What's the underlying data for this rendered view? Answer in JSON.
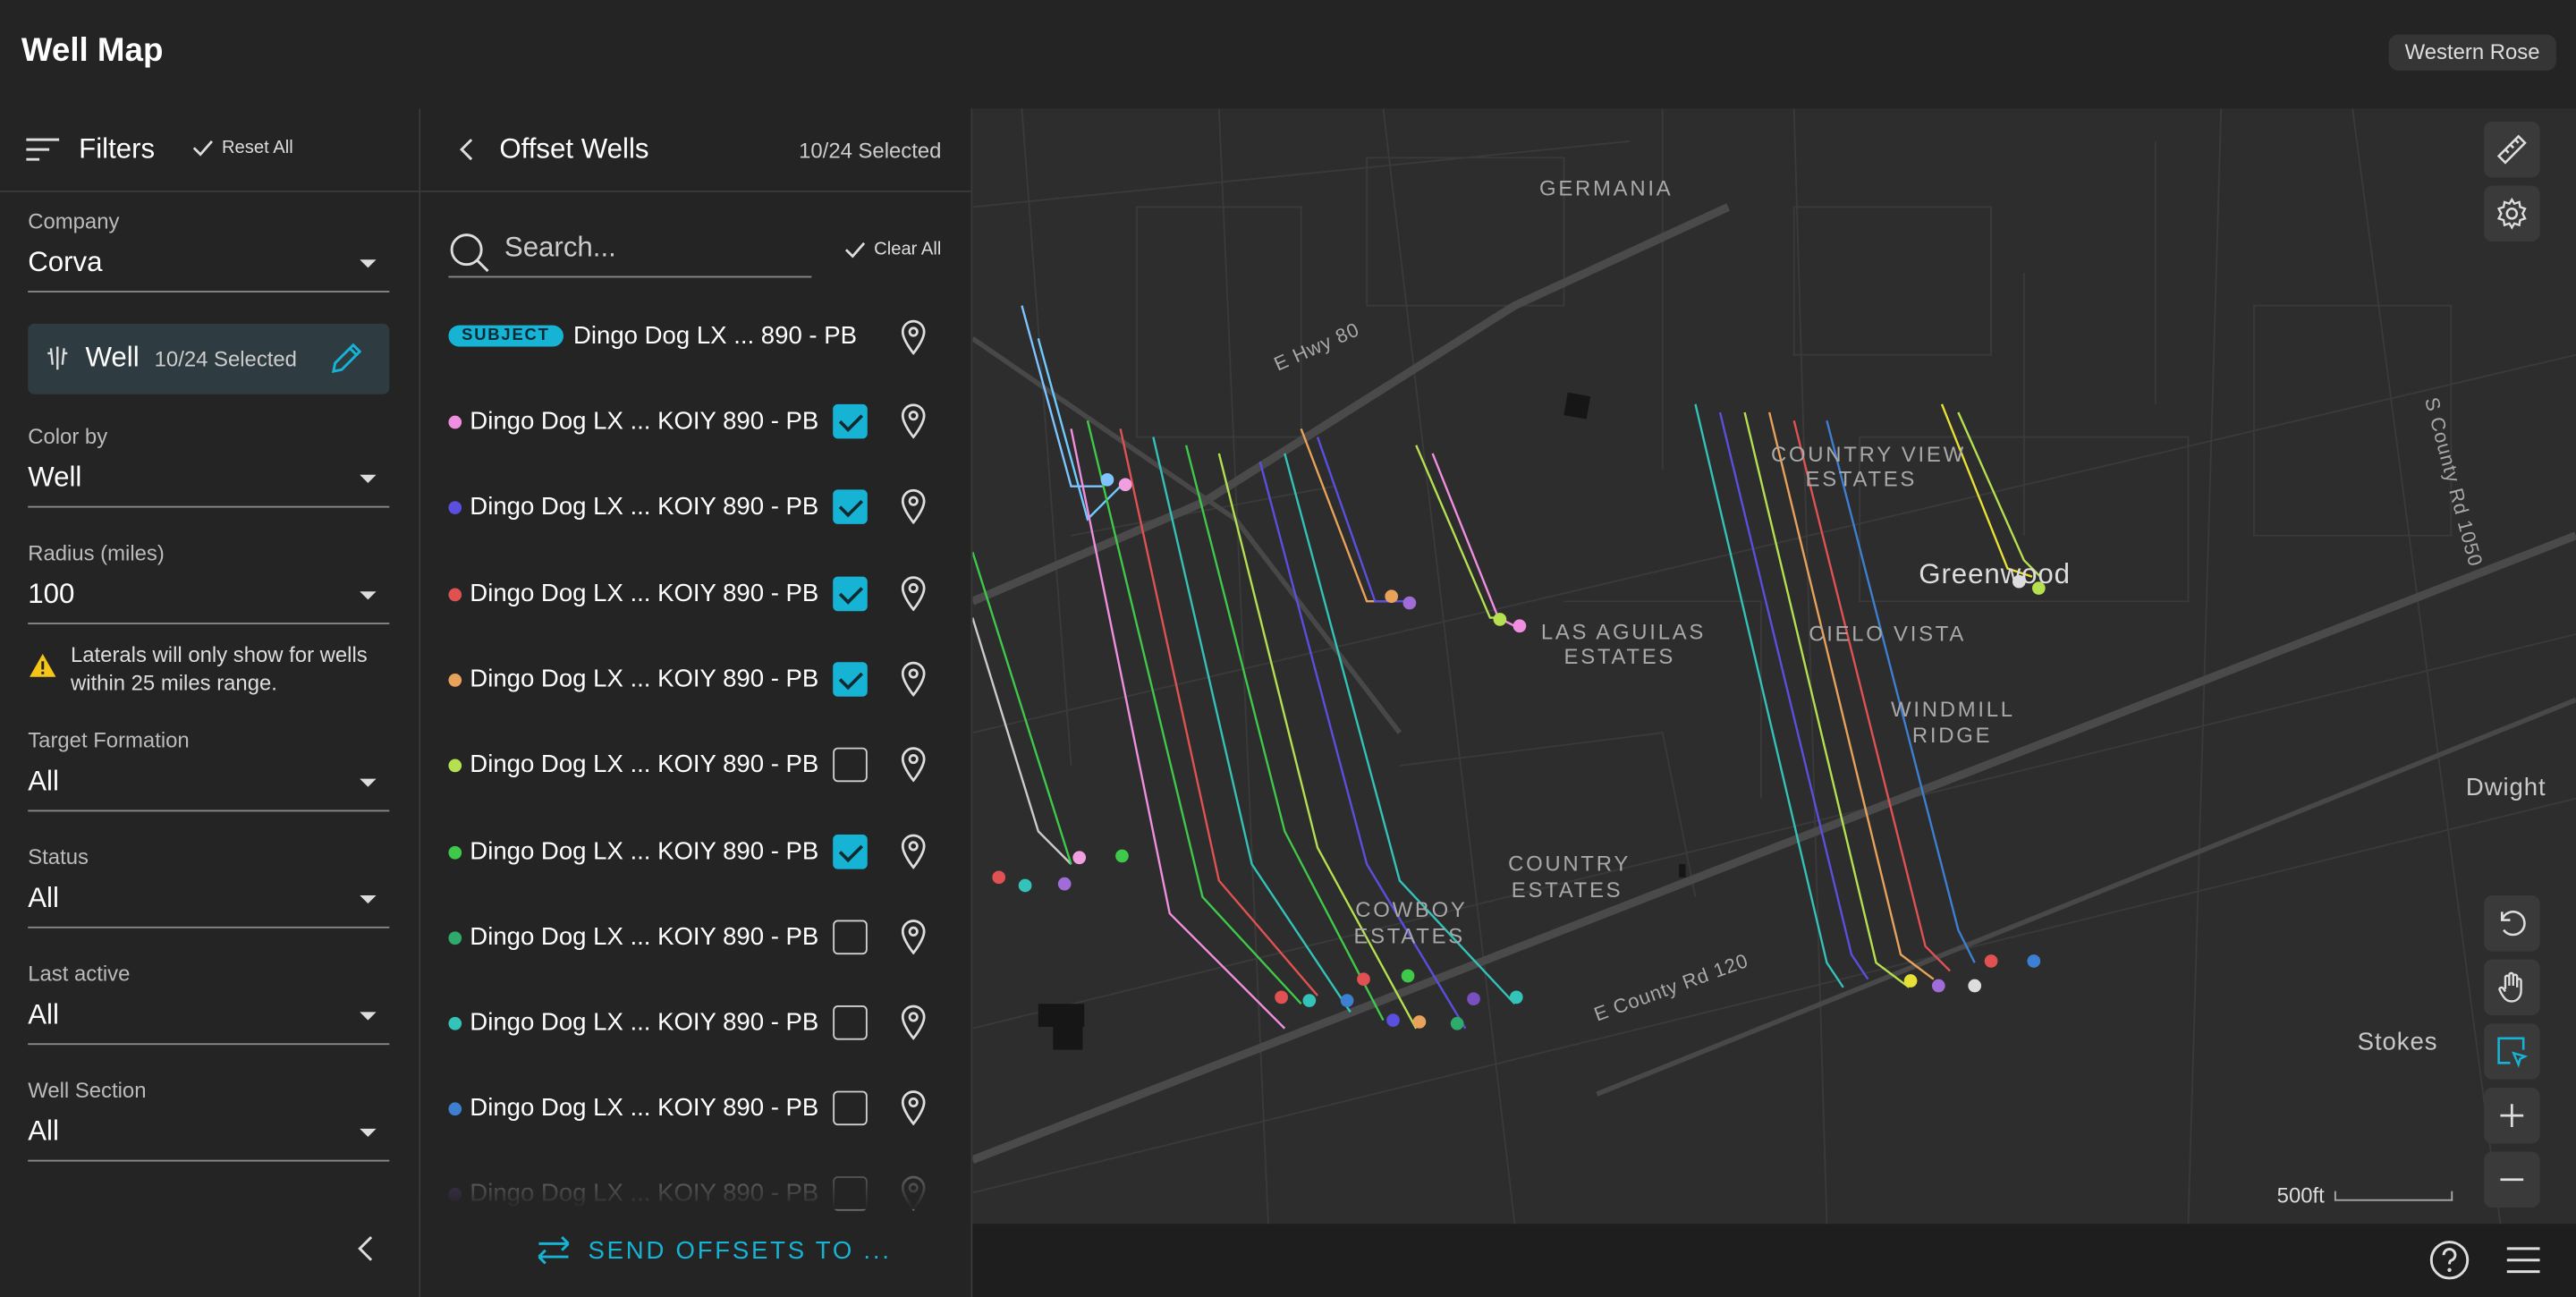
{
  "app": {
    "title": "Well Map",
    "company": "Western Rose"
  },
  "filters": {
    "title": "Filters",
    "reset_label": "Reset All",
    "company": {
      "label": "Company",
      "value": "Corva"
    },
    "well": {
      "label": "Well",
      "count": "10/24 Selected"
    },
    "color_by": {
      "label": "Color by",
      "value": "Well"
    },
    "radius": {
      "label": "Radius (miles)",
      "value": "100"
    },
    "warning": "Laterals will only show for wells within 25 miles range.",
    "target_formation": {
      "label": "Target Formation",
      "value": "All"
    },
    "status": {
      "label": "Status",
      "value": "All"
    },
    "last_active": {
      "label": "Last active",
      "value": "All"
    },
    "well_section": {
      "label": "Well Section",
      "value": "All"
    }
  },
  "offset": {
    "title": "Offset Wells",
    "count": "10/24 Selected",
    "search_placeholder": "Search...",
    "clear_label": "Clear All",
    "subject": {
      "badge": "SUBJECT",
      "name": "Dingo Dog LX  ...  890 - PB"
    },
    "wells": [
      {
        "name": "Dingo Dog LX  ... KOIY 890 - PB",
        "color": "#f08ee0",
        "checked": true
      },
      {
        "name": "Dingo Dog LX  ... KOIY 890 - PB",
        "color": "#5b4fe0",
        "checked": true
      },
      {
        "name": "Dingo Dog LX  ... KOIY 890 - PB",
        "color": "#e05252",
        "checked": true
      },
      {
        "name": "Dingo Dog LX  ... KOIY 890 - PB",
        "color": "#e8a25a",
        "checked": true
      },
      {
        "name": "Dingo Dog LX  ... KOIY 890 - PB",
        "color": "#b5e04f",
        "checked": false
      },
      {
        "name": "Dingo Dog LX  ... KOIY 890 - PB",
        "color": "#3fc94a",
        "checked": true
      },
      {
        "name": "Dingo Dog LX  ... KOIY 890 - PB",
        "color": "#2eab6a",
        "checked": false
      },
      {
        "name": "Dingo Dog LX  ... KOIY 890 - PB",
        "color": "#33c3b9",
        "checked": false
      },
      {
        "name": "Dingo Dog LX  ... KOIY 890 - PB",
        "color": "#3d7fd1",
        "checked": false
      },
      {
        "name": "Dingo Dog LX  ... KOIY 890 - PB",
        "color": "#7a4fc0",
        "checked": false
      }
    ],
    "send_label": "SEND OFFSETS TO ..."
  },
  "map": {
    "labels": {
      "germania": "GERMANIA",
      "hwy80": "E Hwy 80",
      "country_view_1": "COUNTRY VIEW",
      "country_view_2": "ESTATES",
      "greenwood": "Greenwood",
      "aguilas_1": "LAS AGUILAS",
      "aguilas_2": "ESTATES",
      "cielo": "CIELO VISTA",
      "windmill_1": "WINDMILL",
      "windmill_2": "RIDGE",
      "country_1": "COUNTRY",
      "country_2": "ESTATES",
      "cowboy_1": "COWBOY",
      "cowboy_2": "ESTATES",
      "county120": "E County Rd 120",
      "county1050": "S County Rd 1050",
      "dwight": "Dwight",
      "stokes": "Stokes"
    },
    "scale": "500ft"
  }
}
